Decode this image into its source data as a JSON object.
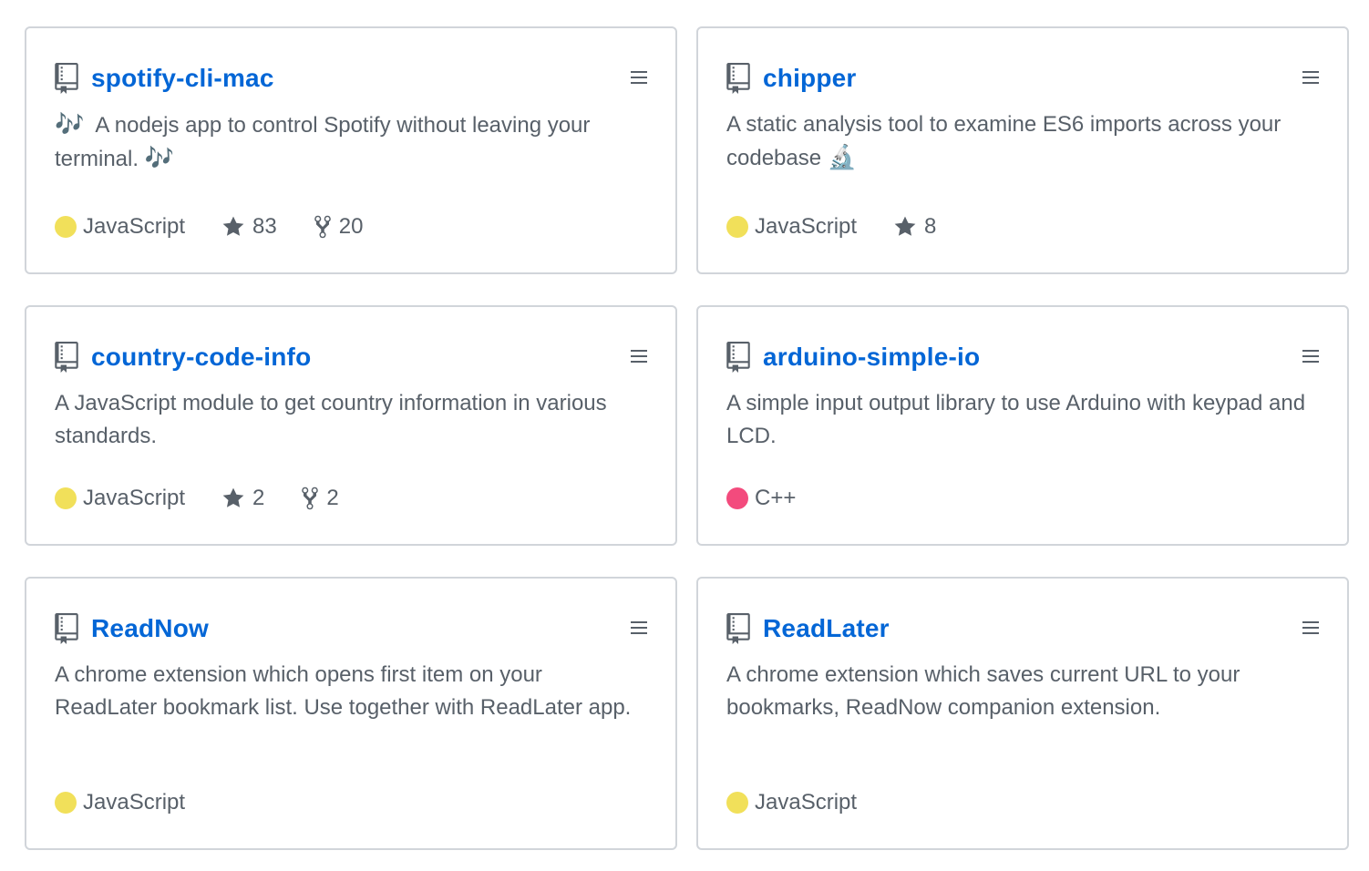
{
  "colors": {
    "link": "#0366d6",
    "border": "#d1d5da",
    "muted": "#586069",
    "javascript": "#f1e05a",
    "cpp": "#f34b7d"
  },
  "repos": [
    {
      "name": "spotify-cli-mac",
      "description_prefix": "🎶",
      "description": "A nodejs app to control Spotify without leaving your terminal.",
      "description_suffix": "🎶",
      "language": "JavaScript",
      "language_color": "#f1e05a",
      "stars": "83",
      "forks": "20"
    },
    {
      "name": "chipper",
      "description": "A static analysis tool to examine ES6 imports across your codebase",
      "description_suffix": "🔬",
      "language": "JavaScript",
      "language_color": "#f1e05a",
      "stars": "8"
    },
    {
      "name": "country-code-info",
      "description": "A JavaScript module to get country information in various standards.",
      "language": "JavaScript",
      "language_color": "#f1e05a",
      "stars": "2",
      "forks": "2"
    },
    {
      "name": "arduino-simple-io",
      "description": "A simple input output library to use Arduino with keypad and LCD.",
      "language": "C++",
      "language_color": "#f34b7d"
    },
    {
      "name": "ReadNow",
      "description": "A chrome extension which opens first item on your ReadLater bookmark list. Use together with ReadLater app.",
      "language": "JavaScript",
      "language_color": "#f1e05a"
    },
    {
      "name": "ReadLater",
      "description": "A chrome extension which saves current URL to your bookmarks, ReadNow companion extension.",
      "language": "JavaScript",
      "language_color": "#f1e05a"
    }
  ],
  "icons": {
    "repo": "repo-icon",
    "drag": "drag-handle-icon",
    "star": "star-icon",
    "fork": "fork-icon"
  }
}
